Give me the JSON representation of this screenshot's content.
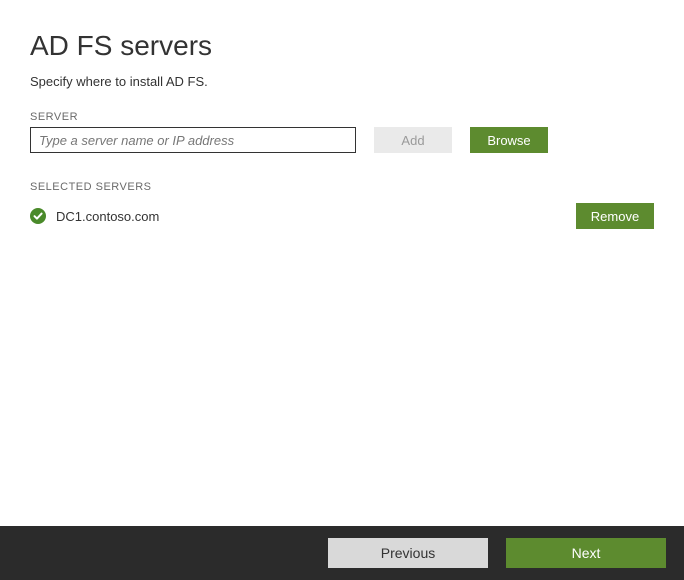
{
  "header": {
    "title": "AD FS servers",
    "subtitle": "Specify where to install AD FS."
  },
  "serverField": {
    "label": "SERVER",
    "placeholder": "Type a server name or IP address",
    "addLabel": "Add",
    "browseLabel": "Browse"
  },
  "selected": {
    "label": "SELECTED SERVERS",
    "removeLabel": "Remove",
    "items": [
      {
        "name": "DC1.contoso.com"
      }
    ]
  },
  "footer": {
    "previous": "Previous",
    "next": "Next"
  }
}
